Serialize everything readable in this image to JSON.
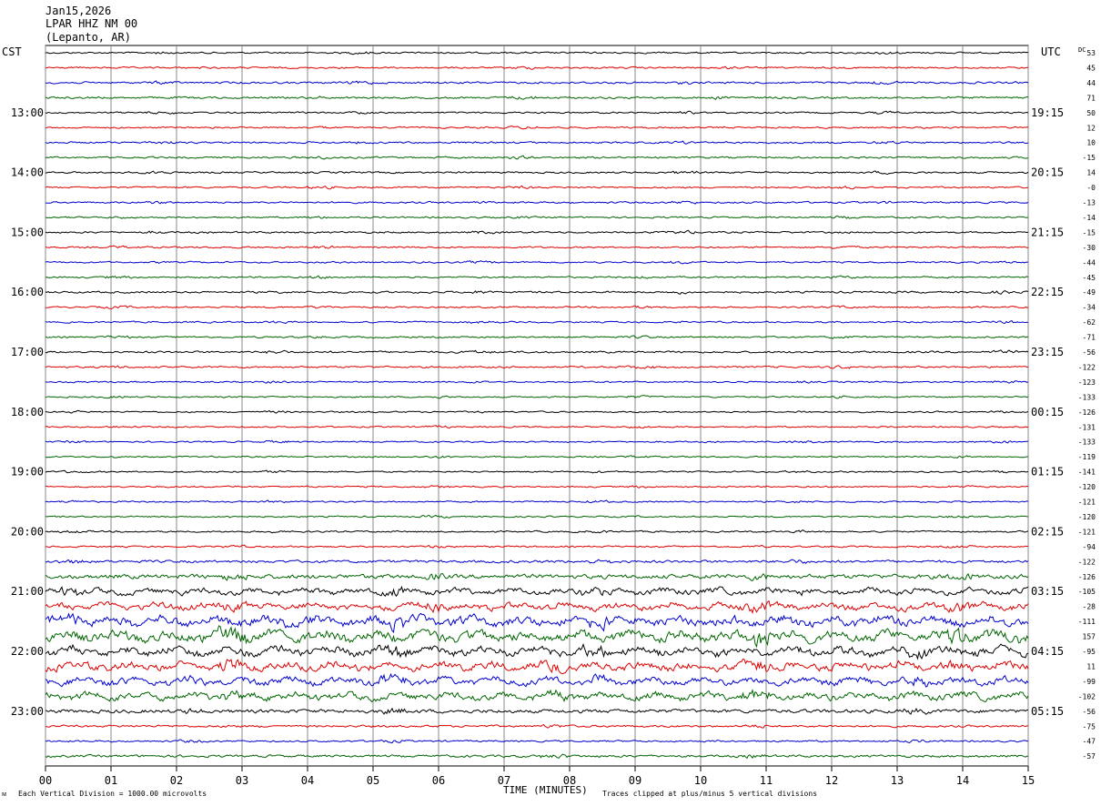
{
  "header": {
    "date": "Jan15,2026",
    "station": "LPAR HHZ NM 00",
    "location": "(Lepanto, AR)"
  },
  "left_tz": "CST",
  "right_tz": "UTC",
  "dc_label": "DC",
  "footer": {
    "left_mark": "ᴍ",
    "scale_note": "Each Vertical Division = 1000.00 microvolts",
    "clip_note": "Traces clipped at plus/minus 5 vertical divisions"
  },
  "colors": {
    "black": "#000000",
    "red": "#dd0000",
    "blue": "#0000cc",
    "green": "#006400",
    "grid": "#888888"
  },
  "chart_data": {
    "type": "line",
    "xlabel": "TIME (MINUTES)",
    "xlim": [
      0,
      15
    ],
    "x_ticks": [
      "00",
      "01",
      "02",
      "03",
      "04",
      "05",
      "06",
      "07",
      "08",
      "09",
      "10",
      "11",
      "12",
      "13",
      "14",
      "15"
    ],
    "trace_count": 48,
    "trace_color_cycle": [
      "black",
      "red",
      "blue",
      "green"
    ],
    "left_hour_labels": [
      {
        "trace": 4,
        "label": "13:00"
      },
      {
        "trace": 8,
        "label": "14:00"
      },
      {
        "trace": 12,
        "label": "15:00"
      },
      {
        "trace": 16,
        "label": "16:00"
      },
      {
        "trace": 20,
        "label": "17:00"
      },
      {
        "trace": 24,
        "label": "18:00"
      },
      {
        "trace": 28,
        "label": "19:00"
      },
      {
        "trace": 32,
        "label": "20:00"
      },
      {
        "trace": 36,
        "label": "21:00"
      },
      {
        "trace": 40,
        "label": "22:00"
      },
      {
        "trace": 44,
        "label": "23:00"
      }
    ],
    "right_hour_labels": [
      {
        "trace": 4,
        "label": "19:15"
      },
      {
        "trace": 8,
        "label": "20:15"
      },
      {
        "trace": 12,
        "label": "21:15"
      },
      {
        "trace": 16,
        "label": "22:15"
      },
      {
        "trace": 20,
        "label": "23:15"
      },
      {
        "trace": 24,
        "label": "00:15"
      },
      {
        "trace": 28,
        "label": "01:15"
      },
      {
        "trace": 32,
        "label": "02:15"
      },
      {
        "trace": 36,
        "label": "03:15"
      },
      {
        "trace": 40,
        "label": "04:15"
      },
      {
        "trace": 44,
        "label": "05:15"
      }
    ],
    "dc_offsets": [
      "53",
      "45",
      "44",
      "71",
      "50",
      "12",
      "10",
      "-15",
      "14",
      "-0",
      "-13",
      "-14",
      "-15",
      "-30",
      "-44",
      "-45",
      "-49",
      "-34",
      "-62",
      "-71",
      "-56",
      "-122",
      "-123",
      "-133",
      "-126",
      "-131",
      "-133",
      "-119",
      "-141",
      "-120",
      "-121",
      "-120",
      "-121",
      "-94",
      "-122",
      "-126",
      "-105",
      "-28",
      "-111",
      "157",
      "-95",
      "11",
      "-99",
      "-102",
      "-56",
      "-75",
      "-47",
      "-57"
    ],
    "trace_activity": [
      1,
      1,
      1.2,
      1.2,
      1,
      1,
      1.1,
      1.1,
      1.1,
      1,
      1.1,
      1,
      1.1,
      1,
      1,
      1,
      1.2,
      1,
      1,
      1,
      1.2,
      1.1,
      0.9,
      0.9,
      0.9,
      0.9,
      0.9,
      0.9,
      0.9,
      0.9,
      0.9,
      0.9,
      1,
      1,
      1.6,
      2.6,
      3.2,
      3.6,
      5,
      5.5,
      4.5,
      4.2,
      3.8,
      3.8,
      2.2,
      1.3,
      1.1,
      1.5
    ]
  }
}
